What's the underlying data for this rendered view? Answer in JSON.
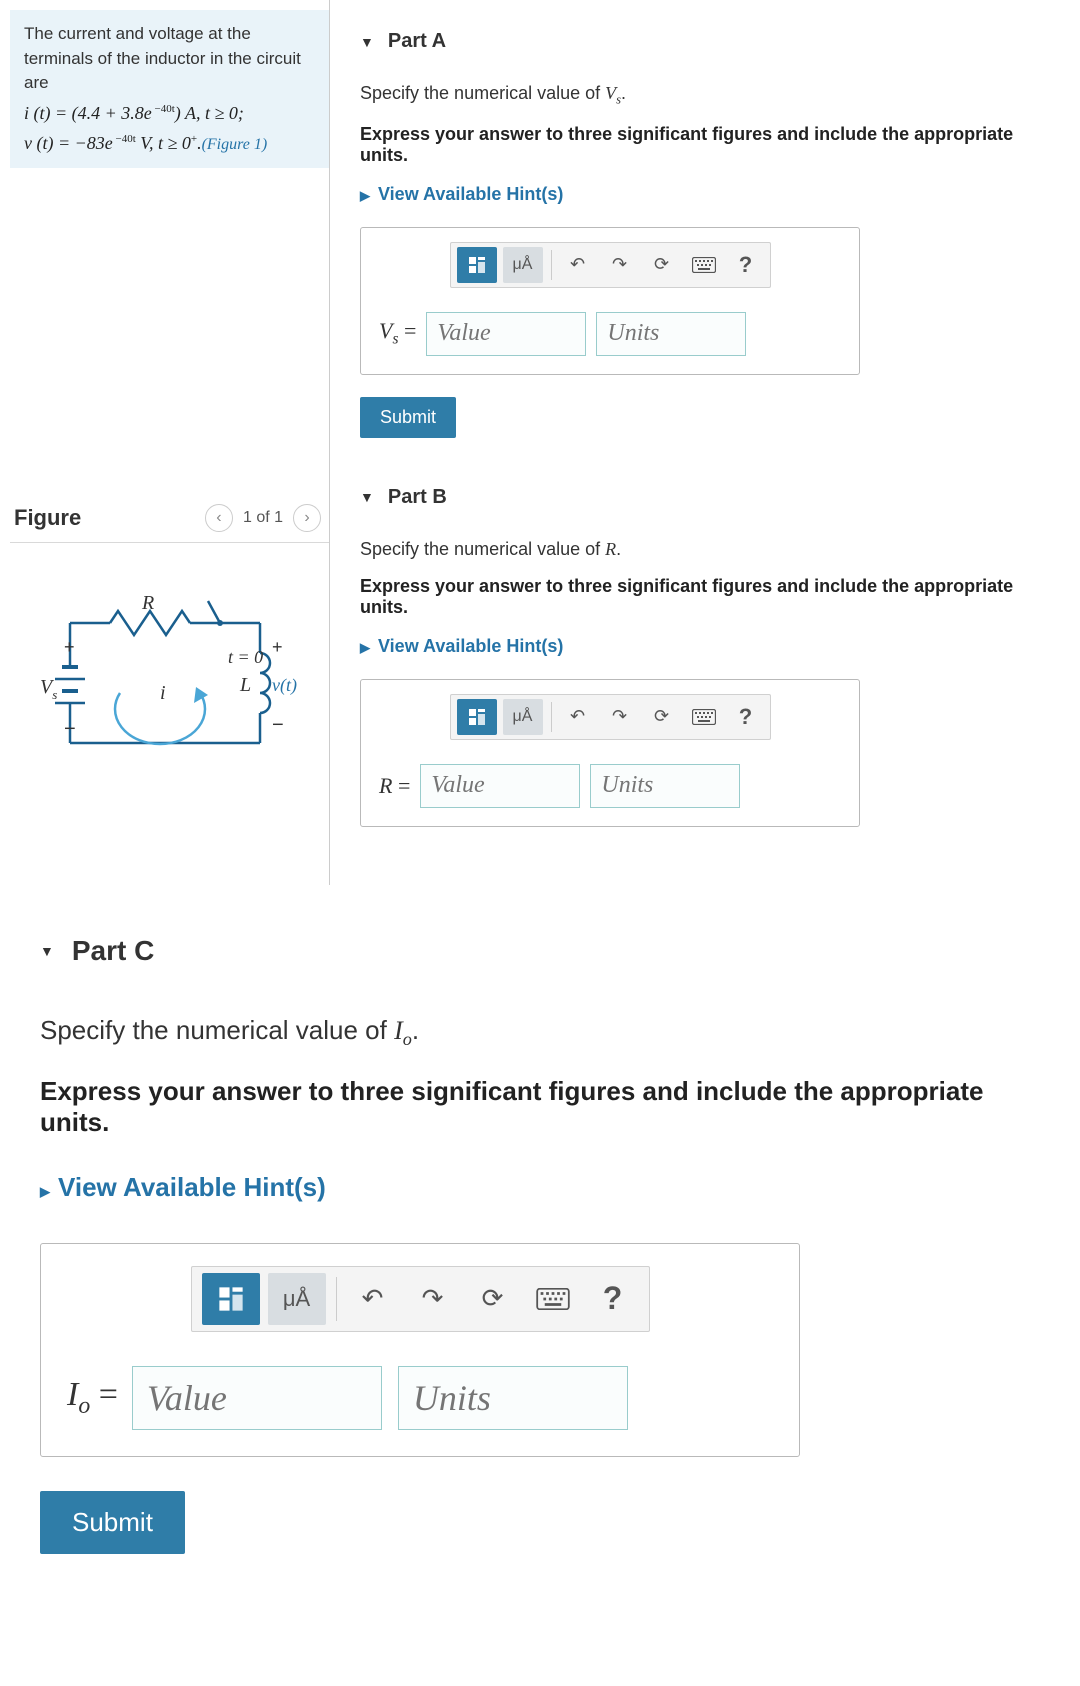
{
  "problem": {
    "intro": "The current and voltage at the terminals of the inductor in the circuit are",
    "eq1_html": "i (t) = (4.4 + 3.8e<sup> −40t</sup>) A,  t ≥ 0;",
    "eq2_prefix_html": "v (t) = −83e<sup> −40t</sup> V,  t ≥ 0<sup>+</sup>.",
    "figure_link": "(Figure 1)"
  },
  "figure": {
    "title": "Figure",
    "page_label": "1 of 1",
    "labels": {
      "R": "R",
      "Vs": "V",
      "Vs_sub": "s",
      "i": "i",
      "t0": "t = 0",
      "L": "L",
      "vt": "v(t)"
    }
  },
  "parts": {
    "A": {
      "title": "Part A",
      "spec_html": "Specify the numerical value of <i>V<sub>s</sub></i>.",
      "express": "Express your answer to three significant figures and include the appropriate units.",
      "hints": "View Available Hint(s)",
      "var_html": "<i>V<sub>s</sub></i> =",
      "value_ph": "Value",
      "units_ph": "Units",
      "submit": "Submit"
    },
    "B": {
      "title": "Part B",
      "spec_html": "Specify the numerical value of <i>R</i>.",
      "express": "Express your answer to three significant figures and include the appropriate units.",
      "hints": "View Available Hint(s)",
      "var_html": "<i>R</i> =",
      "value_ph": "Value",
      "units_ph": "Units"
    },
    "C": {
      "title": "Part C",
      "spec_html": "Specify the numerical value of <i>I<sub>o</sub></i>.",
      "express": "Express your answer to three significant figures and include the appropriate units.",
      "hints": "View Available Hint(s)",
      "var_html": "<i>I<sub>o</sub></i> =",
      "value_ph": "Value",
      "units_ph": "Units",
      "submit": "Submit"
    }
  },
  "toolbar": {
    "templates_title": "templates",
    "units_label": "μÅ",
    "undo_title": "undo",
    "redo_title": "redo",
    "reset_title": "reset",
    "keyboard_title": "keyboard",
    "help_label": "?"
  }
}
